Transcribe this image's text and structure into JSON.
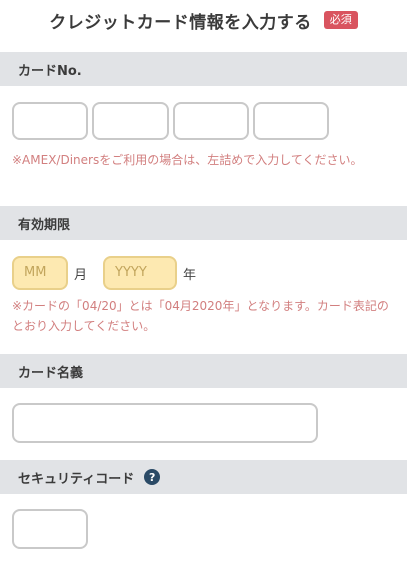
{
  "header": {
    "title": "クレジットカード情報を入力する",
    "required_badge": "必須"
  },
  "card_number": {
    "label": "カードNo.",
    "note": "※AMEX/Dinersをご利用の場合は、左詰めで入力してください。"
  },
  "expiry": {
    "label": "有効期限",
    "month_placeholder": "MM",
    "month_unit": "月",
    "year_placeholder": "YYYY",
    "year_unit": "年",
    "note": "※カードの「04/20」とは「04月2020年」となります。カード表記のとおり入力してください。"
  },
  "card_name": {
    "label": "カード名義"
  },
  "security_code": {
    "label": "セキュリティコード",
    "help_icon": "?"
  },
  "colors": {
    "accent_red": "#d9545f",
    "note_text": "#d27f7f",
    "section_bg": "#e1e3e6",
    "expiry_field_bg": "#fde9b1",
    "help_icon_bg": "#2a4a66"
  }
}
